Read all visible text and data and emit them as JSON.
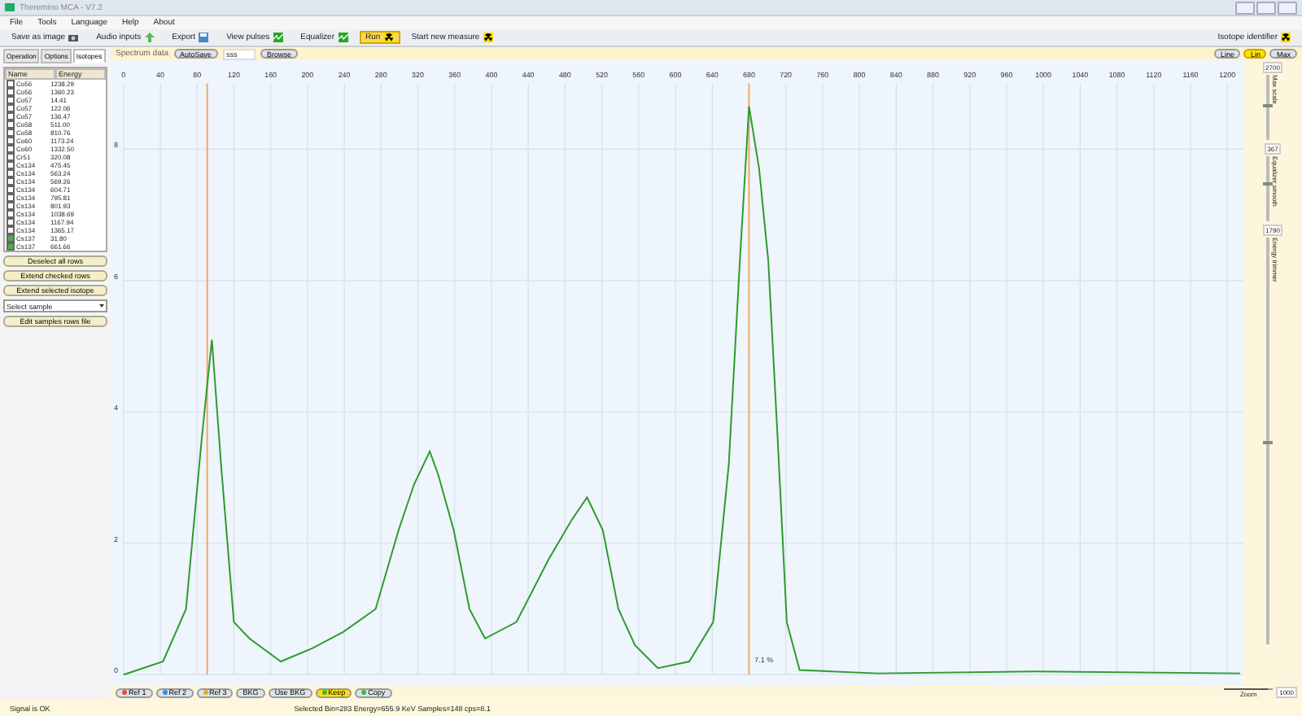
{
  "window": {
    "title": "Theremino MCA - V7.2"
  },
  "menu": [
    "File",
    "Tools",
    "Language",
    "Help",
    "About"
  ],
  "toolbar": [
    {
      "label": "Save as image",
      "kind": "camera",
      "selected": false
    },
    {
      "label": "Audio inputs",
      "kind": "arrow",
      "selected": false
    },
    {
      "label": "Export",
      "kind": "disk",
      "selected": false
    },
    {
      "label": "View pulses",
      "kind": "pulse",
      "selected": false
    },
    {
      "label": "Equalizer",
      "kind": "pulse",
      "selected": false
    },
    {
      "label": "Run",
      "kind": "radiation",
      "selected": true
    },
    {
      "label": "Start new measure",
      "kind": "radiation",
      "selected": false
    }
  ],
  "toolbar_right": {
    "label": "Isotope identifier"
  },
  "side_tabs": [
    {
      "label": "Operation",
      "selected": false
    },
    {
      "label": "Options",
      "selected": false
    },
    {
      "label": "Isotopes",
      "selected": true
    }
  ],
  "isotopes": {
    "columns": [
      "Name",
      "Energy"
    ],
    "rows": [
      {
        "name": "Co56",
        "energy": "1238.29",
        "checked": false
      },
      {
        "name": "Co56",
        "energy": "1360.23",
        "checked": false
      },
      {
        "name": "Co57",
        "energy": "14.41",
        "checked": false
      },
      {
        "name": "Co57",
        "energy": "122.06",
        "checked": false
      },
      {
        "name": "Co57",
        "energy": "136.47",
        "checked": false
      },
      {
        "name": "Co58",
        "energy": "511.00",
        "checked": false
      },
      {
        "name": "Co58",
        "energy": "810.76",
        "checked": false
      },
      {
        "name": "Co60",
        "energy": "1173.24",
        "checked": false
      },
      {
        "name": "Co60",
        "energy": "1332.50",
        "checked": false
      },
      {
        "name": "Cr51",
        "energy": "320.08",
        "checked": false
      },
      {
        "name": "Cs134",
        "energy": "475.45",
        "checked": false
      },
      {
        "name": "Cs134",
        "energy": "563.24",
        "checked": false
      },
      {
        "name": "Cs134",
        "energy": "569.26",
        "checked": false
      },
      {
        "name": "Cs134",
        "energy": "604.71",
        "checked": false
      },
      {
        "name": "Cs134",
        "energy": "795.81",
        "checked": false
      },
      {
        "name": "Cs134",
        "energy": "801.93",
        "checked": false
      },
      {
        "name": "Cs134",
        "energy": "1038.69",
        "checked": false
      },
      {
        "name": "Cs134",
        "energy": "1167.94",
        "checked": false
      },
      {
        "name": "Cs134",
        "energy": "1365.17",
        "checked": false
      },
      {
        "name": "Cs137",
        "energy": "31.80",
        "checked": true
      },
      {
        "name": "Cs137",
        "energy": "661.66",
        "checked": true
      }
    ]
  },
  "side_buttons": [
    "Deselect all rows",
    "Extend checked rows",
    "Extend selected isotope"
  ],
  "sample_select": {
    "value": "Select sample"
  },
  "edit_button": "Edit samples rows file",
  "spectrum_bar": {
    "label": "Spectrum data",
    "autosave": "AutoSave",
    "file": "sss",
    "browse": "Browse"
  },
  "view_buttons": [
    {
      "label": "Line",
      "selected": false
    },
    {
      "label": "Lin",
      "selected": true
    },
    {
      "label": "Max",
      "selected": false
    }
  ],
  "chart_data": {
    "type": "line",
    "grid": true,
    "xlim": [
      0,
      1214
    ],
    "ylim": [
      0,
      9
    ],
    "xticks": [
      0,
      40,
      80,
      120,
      160,
      200,
      240,
      280,
      320,
      360,
      400,
      440,
      480,
      520,
      560,
      600,
      640,
      680,
      720,
      760,
      800,
      840,
      880,
      920,
      960,
      1000,
      1040,
      1080,
      1120,
      1160,
      1200
    ],
    "yticks": [
      0,
      2,
      4,
      6,
      8
    ],
    "x": [
      0,
      43,
      68,
      85,
      96,
      106,
      120,
      137,
      171,
      205,
      239,
      274,
      299,
      316,
      333,
      342,
      359,
      376,
      393,
      427,
      462,
      487,
      504,
      521,
      538,
      556,
      581,
      615,
      641,
      658,
      670,
      680,
      691,
      701,
      711,
      721,
      735,
      820,
      991,
      1214
    ],
    "series": [
      {
        "color": "#2e9a2e",
        "values": [
          0,
          0.2,
          1.0,
          3.6,
          5.1,
          3.2,
          0.8,
          0.55,
          0.2,
          0.4,
          0.65,
          1.0,
          2.2,
          2.9,
          3.4,
          3.05,
          2.2,
          1.0,
          0.55,
          0.8,
          1.75,
          2.35,
          2.7,
          2.2,
          1.0,
          0.45,
          0.1,
          0.2,
          0.8,
          3.2,
          6.3,
          8.65,
          7.7,
          6.3,
          3.65,
          0.8,
          0.07,
          0.02,
          0.05,
          0.02
        ]
      }
    ],
    "ref_lines": [
      {
        "axis": "x",
        "value": 91
      },
      {
        "axis": "x",
        "value": 680
      }
    ]
  },
  "peak_label": "7.1 %",
  "sliders": [
    {
      "label": "Max scale",
      "value": "2700",
      "level": 0.55
    },
    {
      "label": "Equalizer smooth",
      "value": "367",
      "level": 0.6
    },
    {
      "label": "Energy trimmer",
      "value": "1790",
      "level": 0.5
    }
  ],
  "zoom": {
    "label": "Zoom",
    "value": "1000",
    "level": 0.9
  },
  "bottom_buttons": [
    {
      "label": "Ref 1",
      "color": "#e05030",
      "selected": false
    },
    {
      "label": "Ref 2",
      "color": "#3090e0",
      "selected": false
    },
    {
      "label": "Ref 3",
      "color": "#e0b020",
      "selected": false
    },
    {
      "label": "BKG",
      "selected": false
    },
    {
      "label": "Use BKG",
      "selected": false
    },
    {
      "label": "Keep",
      "color": "#30c030",
      "selected": true
    },
    {
      "label": "Copy",
      "color": "#30c030",
      "selected": false
    }
  ],
  "status": {
    "left": "Signal is OK",
    "center": "Selected Bin=283  Energy=655.9 KeV  Samples=148  cps=8.1"
  }
}
